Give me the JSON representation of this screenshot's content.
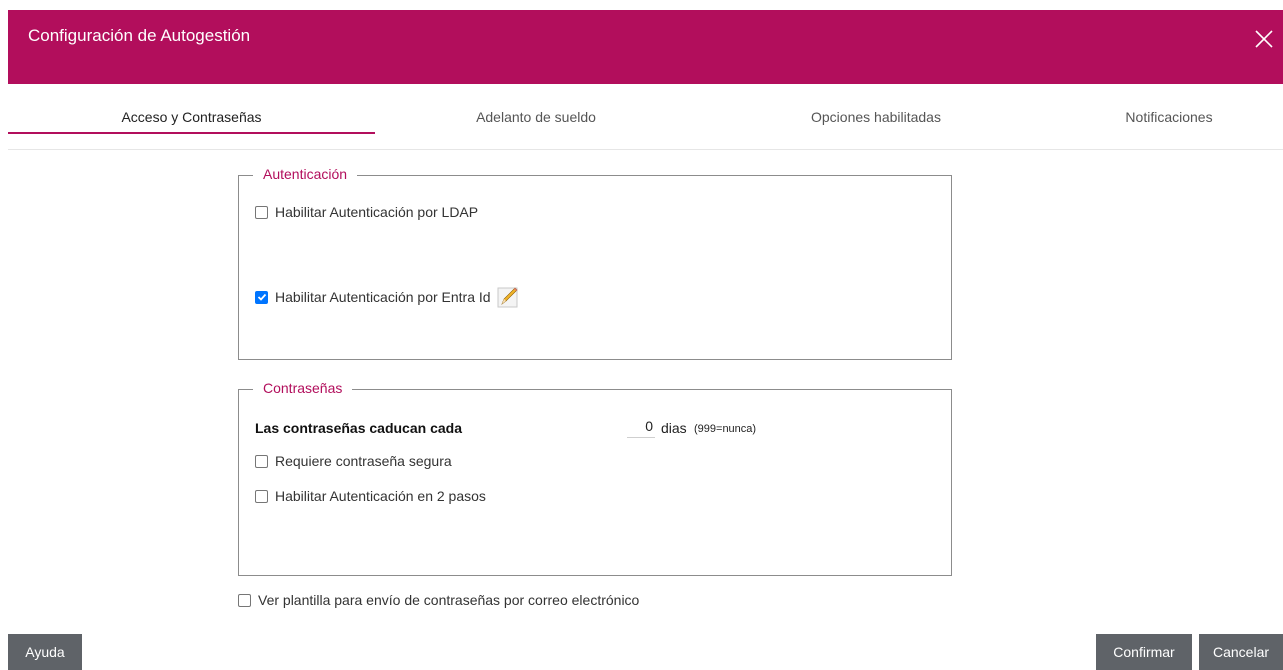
{
  "dialog": {
    "title": "Configuración de Autogestión",
    "accent": "#b20e5c"
  },
  "tabs": [
    {
      "label": "Acceso y Contraseñas",
      "active": true
    },
    {
      "label": "Adelanto de sueldo",
      "active": false
    },
    {
      "label": "Opciones habilitadas",
      "active": false
    },
    {
      "label": "Notificaciones",
      "active": false
    }
  ],
  "auth": {
    "legend": "Autenticación",
    "ldap_label": "Habilitar Autenticación por LDAP",
    "ldap_checked": false,
    "entra_label": "Habilitar Autenticación por Entra Id",
    "entra_checked": true
  },
  "passwords": {
    "legend": "Contraseñas",
    "expire_label": "Las contraseñas caducan cada",
    "expire_days": "0",
    "days_unit": "dias",
    "days_note": "(999=nunca)",
    "secure_label": "Requiere contraseña segura",
    "secure_checked": false,
    "twofa_label": "Habilitar Autenticación en 2 pasos",
    "twofa_checked": false
  },
  "template": {
    "label": "Ver plantilla para envío de contraseñas por correo electrónico",
    "checked": false
  },
  "footer": {
    "help": "Ayuda",
    "confirm": "Confirmar",
    "cancel": "Cancelar"
  },
  "icons": {
    "close": "close-icon",
    "edit": "pencil-icon",
    "check": "checkmark-icon"
  }
}
